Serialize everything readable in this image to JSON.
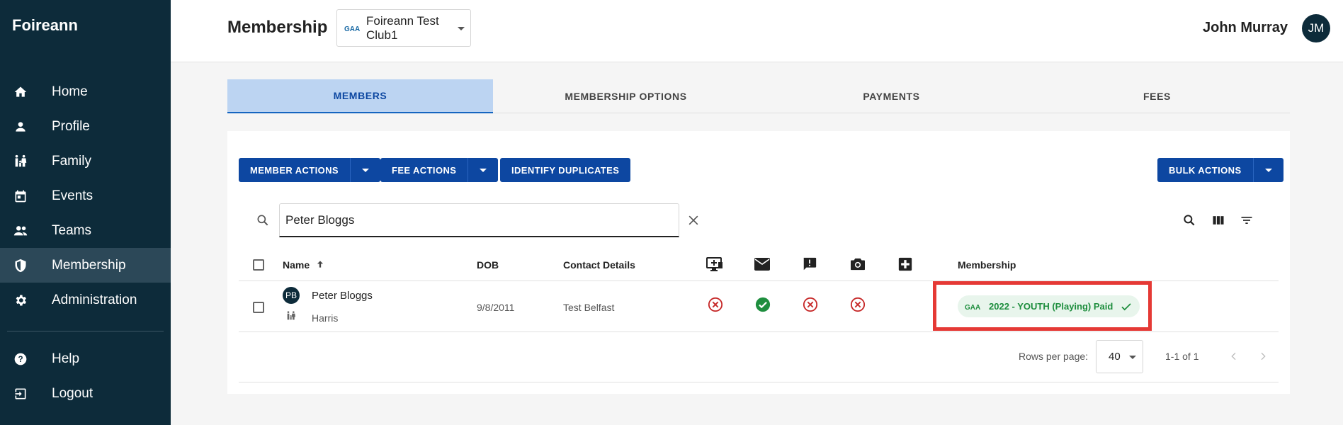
{
  "sidebar": {
    "brand": "Foireann",
    "items": [
      {
        "label": "Home",
        "icon": "home-icon"
      },
      {
        "label": "Profile",
        "icon": "person-icon"
      },
      {
        "label": "Family",
        "icon": "family-icon"
      },
      {
        "label": "Events",
        "icon": "calendar-icon"
      },
      {
        "label": "Teams",
        "icon": "group-icon"
      },
      {
        "label": "Membership",
        "icon": "shield-icon",
        "active": true
      },
      {
        "label": "Administration",
        "icon": "gear-icon"
      }
    ],
    "bottom_items": [
      {
        "label": "Help",
        "icon": "help-icon"
      },
      {
        "label": "Logout",
        "icon": "logout-icon"
      }
    ]
  },
  "header": {
    "title": "Membership",
    "club": "Foireann Test Club1",
    "user_name": "John Murray",
    "user_initials": "JM"
  },
  "tabs": [
    "MEMBERS",
    "MEMBERSHIP OPTIONS",
    "PAYMENTS",
    "FEES"
  ],
  "toolbar": {
    "member_actions": "MEMBER ACTIONS",
    "fee_actions": "FEE ACTIONS",
    "identify_duplicates": "IDENTIFY DUPLICATES",
    "bulk_actions": "BULK ACTIONS"
  },
  "search": {
    "value": "Peter Bloggs"
  },
  "table": {
    "columns": {
      "name": "Name",
      "dob": "DOB",
      "contact": "Contact Details",
      "membership": "Membership"
    },
    "rows": [
      {
        "initials": "PB",
        "name": "Peter Bloggs",
        "family": "Harris",
        "dob": "9/8/2011",
        "contact": "Test Belfast",
        "status": {
          "online_access": "no",
          "email": "yes",
          "alerts": "no",
          "photo": "no"
        },
        "membership": "2022 - YOUTH (Playing) Paid"
      }
    ]
  },
  "pagination": {
    "rows_per_page_label": "Rows per page:",
    "rows_per_page": "40",
    "page_info": "1-1 of 1"
  },
  "colors": {
    "sidebar_bg": "#0d2b3a",
    "primary": "#0d47a1",
    "success": "#1e8e3e",
    "error": "#c62828",
    "highlight": "#e53935"
  }
}
